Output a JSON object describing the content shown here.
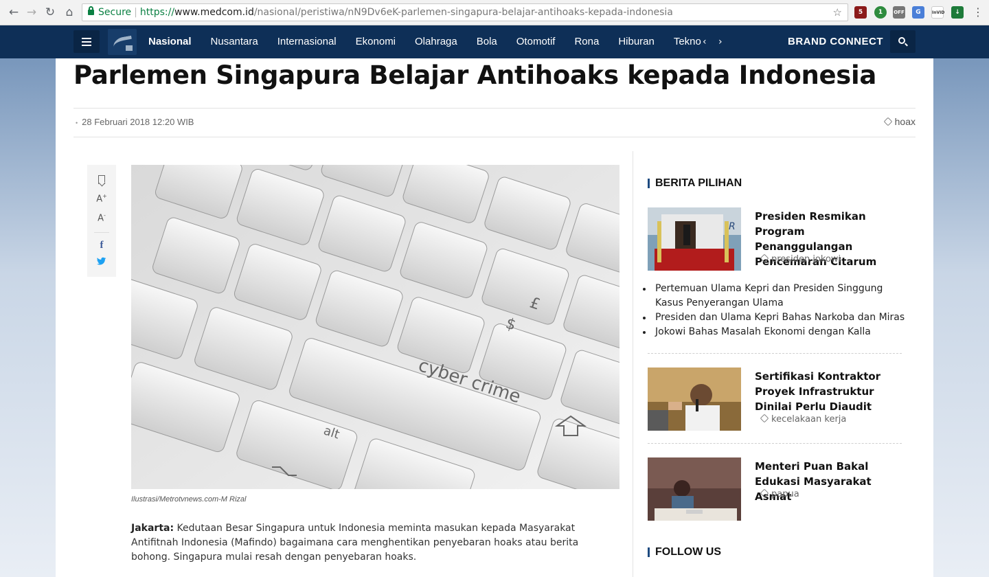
{
  "browser": {
    "secure_label": "Secure",
    "url_scheme": "https://",
    "url_host": "www.medcom.id",
    "url_path": "/nasional/peristiwa/nN9Dv6eK-parlemen-singapura-belajar-antihoaks-kepada-indonesia",
    "extensions": [
      "ublock-icon",
      "extension-green-icon",
      "off-icon",
      "translate-icon",
      "invid-icon",
      "download-icon"
    ],
    "extension_badges": [
      "5",
      "1",
      "OFF",
      "",
      "InVID",
      ""
    ]
  },
  "nav": {
    "items": [
      "Nasional",
      "Nusantara",
      "Internasional",
      "Ekonomi",
      "Olahraga",
      "Bola",
      "Otomotif",
      "Rona",
      "Hiburan",
      "Tekno"
    ],
    "active": "Nasional",
    "brand_connect": "BRAND CONNECT",
    "prev_arrow": "‹",
    "next_arrow": "›"
  },
  "article": {
    "title": "Parlemen Singapura Belajar Antihoaks kepada Indonesia",
    "date": "28 Februari 2018 12:20 WIB",
    "tag": "hoax",
    "image_keys": [
      "cyber crime",
      "alt",
      "£",
      "$"
    ],
    "caption": "Ilustrasi/Metrotvnews.com-M Rizal",
    "lead_location": "Jakarta:",
    "lead_text": "Kedutaan Besar Singapura untuk Indonesia meminta masukan kepada Masyarakat Antifitnah Indonesia (Mafindo) bagaimana cara menghentikan penyebaran hoaks atau berita bohong. Singapura mulai resah dengan penyebaran hoaks.",
    "tools": {
      "font_up": "A",
      "font_down": "A",
      "plus": "+",
      "minus": "-"
    }
  },
  "sidebar": {
    "section_title": "BERITA PILIHAN",
    "news": [
      {
        "title": "Presiden Resmikan Program Penanggulangan Pencemaran Citarum",
        "tag": "presiden jokowi"
      },
      {
        "title": "Sertifikasi Kontraktor Proyek Infrastruktur Dinilai Perlu Diaudit",
        "tag": "kecelakaan kerja"
      },
      {
        "title": "Menteri Puan Bakal Edukasi Masyarakat Asmat",
        "tag": "papua"
      }
    ],
    "related": [
      "Pertemuan Ulama Kepri dan Presiden Singgung Kasus Penyerangan Ulama",
      "Presiden dan Ulama Kepri Bahas Narkoba dan Miras",
      "Jokowi Bahas Masalah Ekonomi dengan Kalla"
    ],
    "follow_title": "FOLLOW US"
  },
  "colors": {
    "nav_bg": "#0e2f57",
    "accent": "#1d4a80",
    "secure_green": "#0b8043"
  }
}
